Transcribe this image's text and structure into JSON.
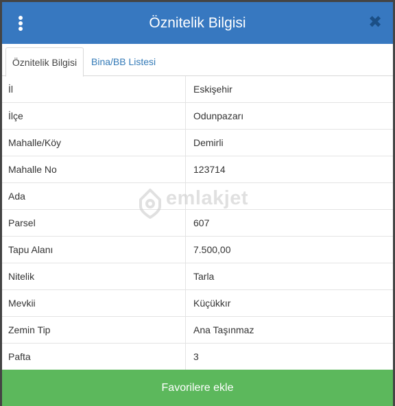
{
  "header": {
    "title": "Öznitelik Bilgisi",
    "menu_icon": "kebab-vertical-icon",
    "close_icon": "close-icon",
    "close_glyph": "✖"
  },
  "tabs": [
    {
      "label": "Öznitelik Bilgisi",
      "active": true
    },
    {
      "label": "Bina/BB Listesi",
      "active": false
    }
  ],
  "rows": [
    {
      "key": "İl",
      "value": "Eskişehir"
    },
    {
      "key": "İlçe",
      "value": "Odunpazarı"
    },
    {
      "key": "Mahalle/Köy",
      "value": "Demirli"
    },
    {
      "key": "Mahalle No",
      "value": "123714"
    },
    {
      "key": "Ada",
      "value": ""
    },
    {
      "key": "Parsel",
      "value": "607"
    },
    {
      "key": "Tapu Alanı",
      "value": "7.500,00"
    },
    {
      "key": "Nitelik",
      "value": "Tarla"
    },
    {
      "key": "Mevkii",
      "value": "Küçükkır"
    },
    {
      "key": "Zemin Tip",
      "value": "Ana Taşınmaz"
    },
    {
      "key": "Pafta",
      "value": "3"
    }
  ],
  "watermark": {
    "text": "emlakjet"
  },
  "footer": {
    "button_label": "Favorilere ekle"
  },
  "colors": {
    "header": "#3778c0",
    "tab_link": "#337ab7",
    "footer": "#5cb85c",
    "close": "#1b4f86"
  }
}
